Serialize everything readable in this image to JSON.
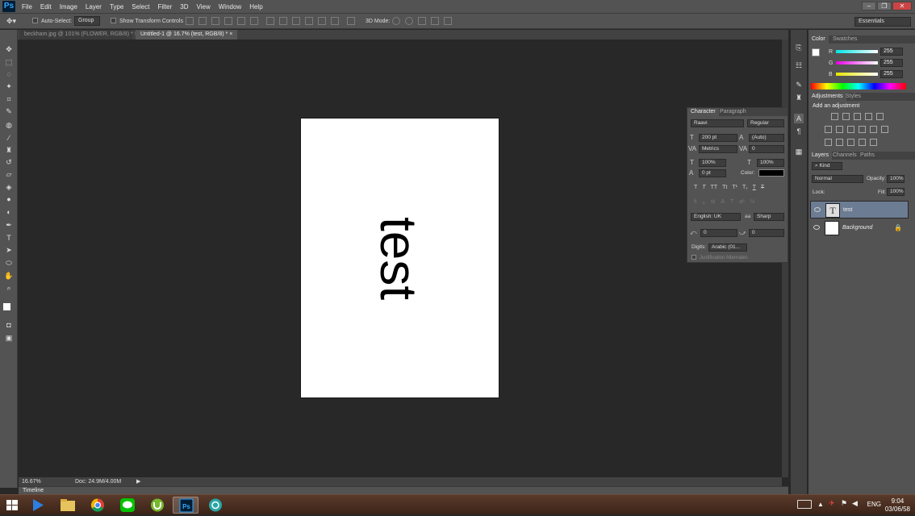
{
  "app": {
    "logo": "Ps"
  },
  "menu": [
    "File",
    "Edit",
    "Image",
    "Layer",
    "Type",
    "Select",
    "Filter",
    "3D",
    "View",
    "Window",
    "Help"
  ],
  "window_controls": [
    "–",
    "❐",
    "✕"
  ],
  "options_bar": {
    "auto_select_label": "Auto-Select:",
    "auto_select_value": "Group",
    "show_transform_label": "Show Transform Controls",
    "mode_3d_label": "3D Mode:"
  },
  "workspace": "Essentials",
  "tabs": [
    {
      "label": "beckham.jpg @ 101% (FLOWER, RGB/8) *",
      "close": "×"
    },
    {
      "label": "Untitled-1 @ 16.7% (test, RGB/8) *",
      "close": "×"
    }
  ],
  "document": {
    "text": "test"
  },
  "status": {
    "zoom": "16.67%",
    "doc": "Doc: 24.9M/4.00M"
  },
  "timeline": {
    "label": "Timeline"
  },
  "color_panel": {
    "tabs": [
      "Color",
      "Swatches"
    ],
    "channels": [
      {
        "label": "R",
        "value": "255",
        "color": "#00d0d0"
      },
      {
        "label": "G",
        "value": "255",
        "color": "#d000d0"
      },
      {
        "label": "B",
        "value": "255",
        "color": "#d0d000"
      }
    ]
  },
  "adjustments_panel": {
    "tabs": [
      "Adjustments",
      "Styles"
    ],
    "heading": "Add an adjustment"
  },
  "layers_panel": {
    "tabs": [
      "Layers",
      "Channels",
      "Paths"
    ],
    "kind": "Kind",
    "blend": "Normal",
    "opacity_label": "Opacity:",
    "opacity": "100%",
    "lock_label": "Lock:",
    "fill_label": "Fill:",
    "fill": "100%",
    "layers": [
      {
        "name": "test",
        "type": "text",
        "selected": true
      },
      {
        "name": "Background",
        "type": "image",
        "selected": false
      }
    ]
  },
  "character_panel": {
    "tabs": [
      "Character",
      "Paragraph"
    ],
    "font": "Raavi",
    "style": "Regular",
    "size": "200 pt",
    "leading": "(Auto)",
    "kerning": "Metrics",
    "tracking": "0",
    "vscale": "100%",
    "hscale": "100%",
    "baseline": "0 pt",
    "color_label": "Color:",
    "language": "English: UK",
    "aa": "Sharp",
    "aa_prefix": "aa",
    "field_a": "0",
    "field_b": "0",
    "digits_label": "Digits:",
    "digits": "Arabic (01...",
    "justification": "Justification Alternates"
  },
  "taskbar": {
    "lang": "ENG",
    "time": "9:04",
    "date": "03/06/58"
  }
}
